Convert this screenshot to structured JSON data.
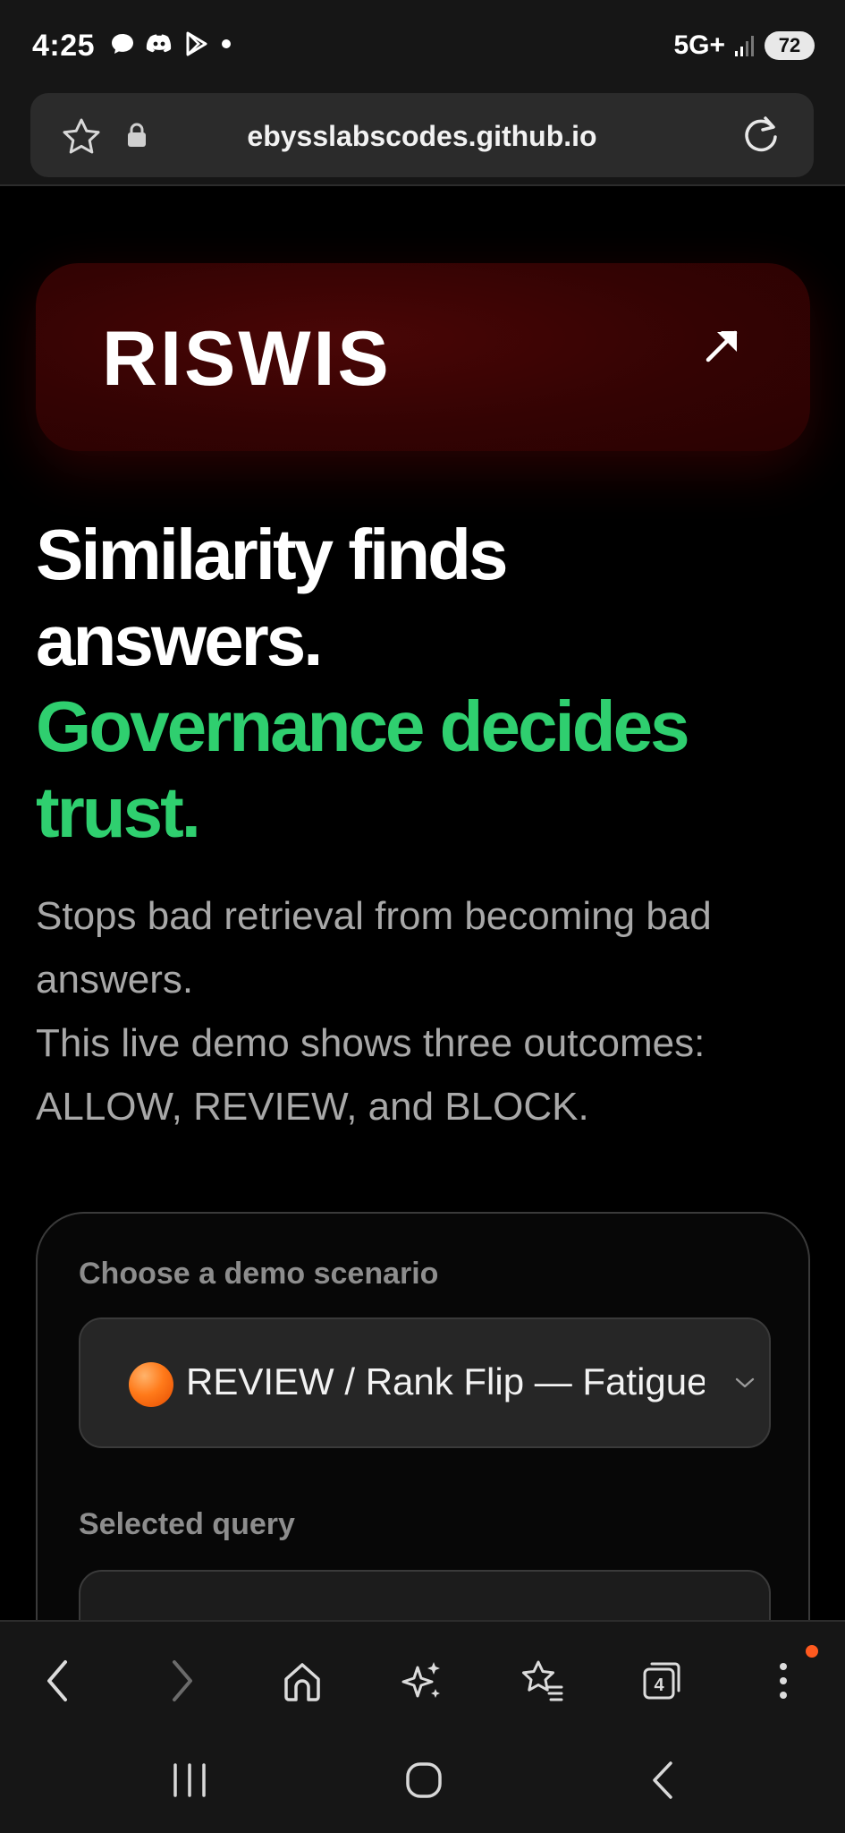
{
  "status_bar": {
    "time": "4:25",
    "network": "5G+",
    "battery": "72",
    "icons": [
      "chat-bubble-icon",
      "discord-icon",
      "play-store-icon",
      "notification-dot"
    ]
  },
  "browser": {
    "url": "ebysslabscodes.github.io",
    "tab_count": "4",
    "toolbar_icons": [
      "back-icon",
      "forward-icon",
      "home-icon",
      "sparkle-icon",
      "bookmarks-icon",
      "tabs-icon",
      "more-icon"
    ]
  },
  "page": {
    "brand": "RISWIS",
    "hero_white": [
      "Similarity finds",
      "answers."
    ],
    "hero_green": [
      "Governance decides",
      "trust."
    ],
    "subtitle_lines": [
      "Stops bad retrieval from becoming bad",
      "answers.",
      "This live demo shows three outcomes:",
      "ALLOW, REVIEW, and BLOCK."
    ],
    "demo": {
      "scenario_label": "Choose a demo scenario",
      "selected_scenario": "REVIEW / Rank Flip — Fatigue",
      "query_label": "Selected query"
    }
  },
  "colors": {
    "accent_green": "#2fcf6f",
    "brand_card": "#340303",
    "review_orange": "#ff7a1a"
  }
}
